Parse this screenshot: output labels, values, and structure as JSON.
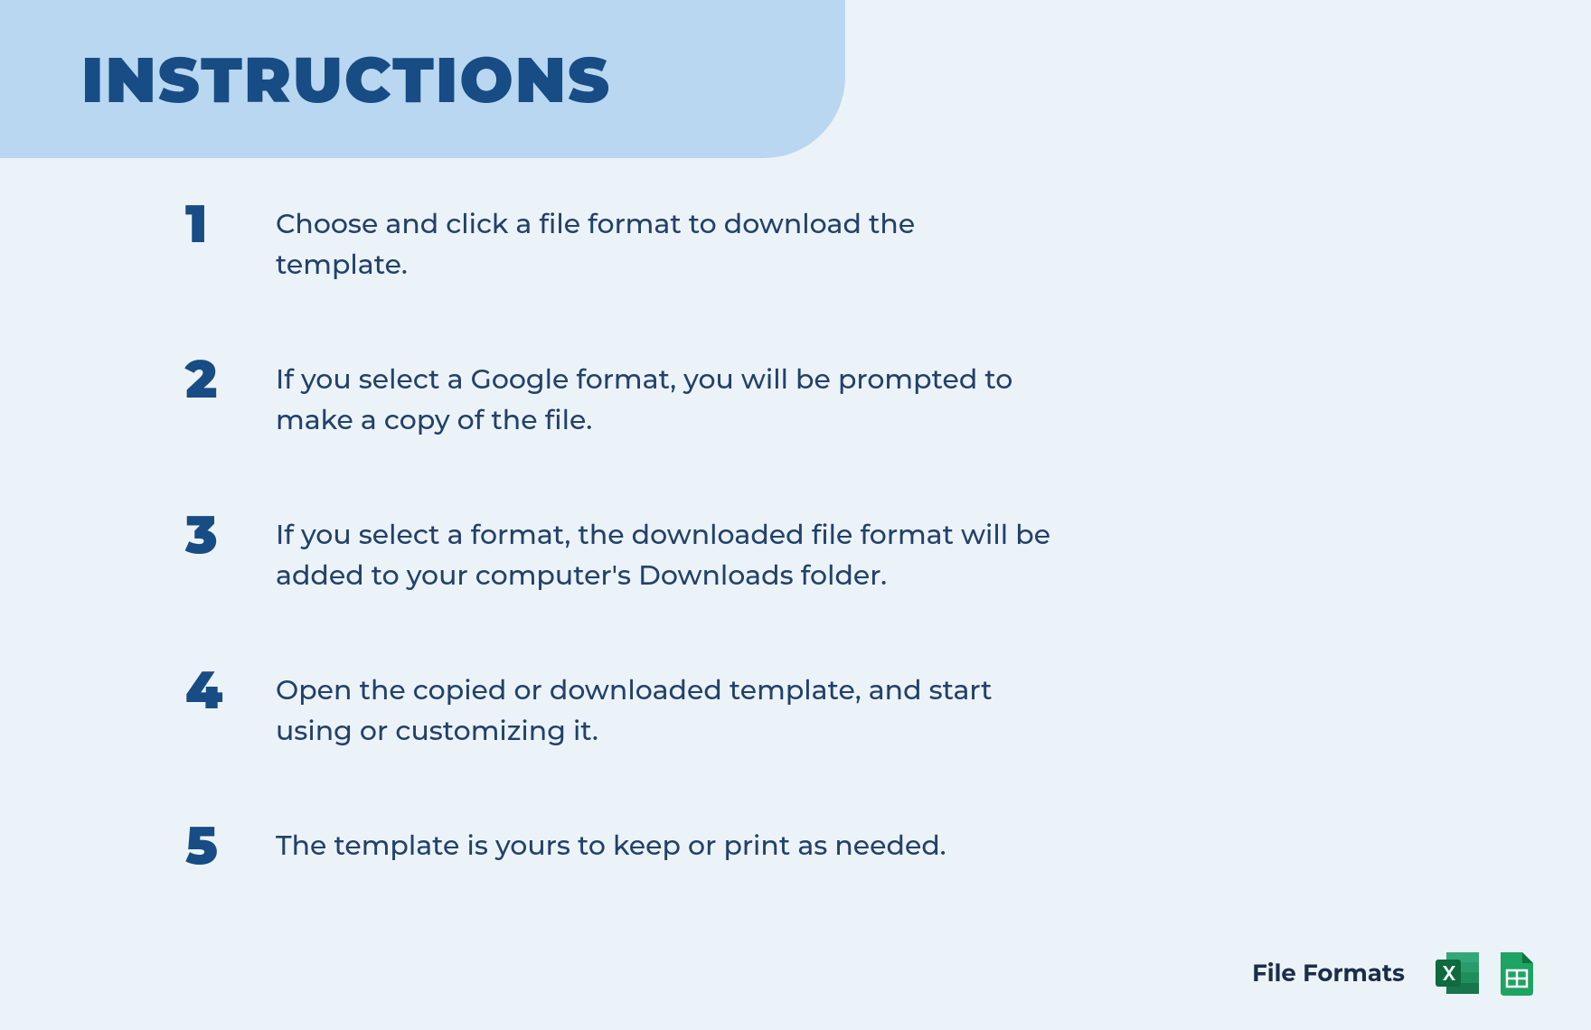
{
  "title": "INSTRUCTIONS",
  "steps": [
    {
      "num": "1",
      "text": "Choose and click a file format to download the template."
    },
    {
      "num": "2",
      "text": "If you select a Google format, you will be prompted to make a copy of the file."
    },
    {
      "num": "3",
      "text": "If you select a format, the downloaded file format will be added to your computer's Downloads folder."
    },
    {
      "num": "4",
      "text": "Open the copied or downloaded template, and start using or customizing it."
    },
    {
      "num": "5",
      "text": "The template is yours to keep or print as needed."
    }
  ],
  "footer": {
    "label": "File Formats",
    "icons": [
      {
        "name": "excel-icon"
      },
      {
        "name": "google-sheets-icon"
      }
    ]
  },
  "colors": {
    "bg": "#ecf3f8",
    "titleBg": "#b9d7f0",
    "primary": "#174c84",
    "bodyText": "#22416b",
    "excel": "#1f8f5a",
    "excelDark": "#0f6a3f",
    "sheets": "#1ea362",
    "sheetsDark": "#0d7341"
  }
}
